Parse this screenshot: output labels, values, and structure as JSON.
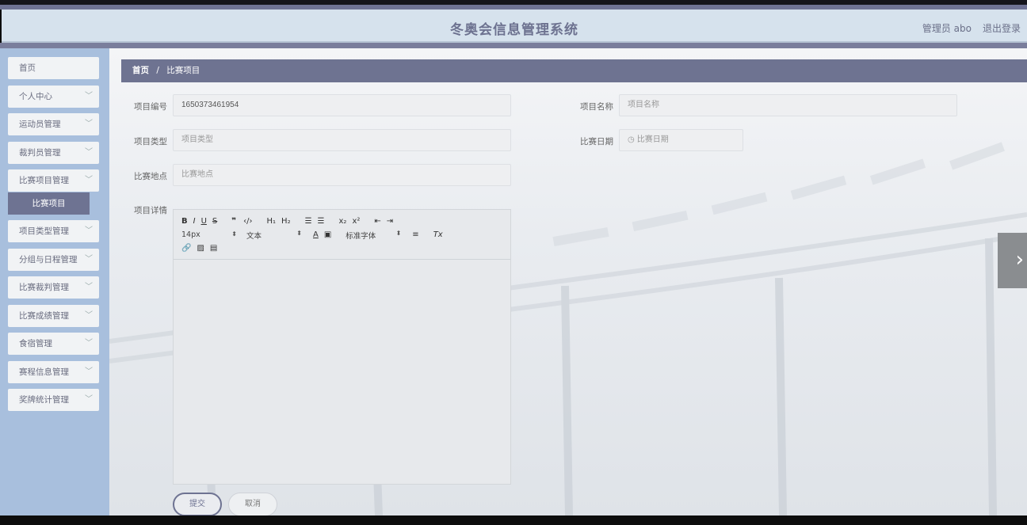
{
  "header": {
    "title": "冬奥会信息管理系统",
    "user": "管理员 abo",
    "logout": "退出登录"
  },
  "sidebar": {
    "items": [
      {
        "label": "首页",
        "has_arrow": false
      },
      {
        "label": "个人中心",
        "has_arrow": true
      },
      {
        "label": "运动员管理",
        "has_arrow": true
      },
      {
        "label": "裁判员管理",
        "has_arrow": true
      },
      {
        "label": "比赛项目管理",
        "has_arrow": true
      },
      {
        "label": "项目类型管理",
        "has_arrow": true
      },
      {
        "label": "分组与日程管理",
        "has_arrow": true
      },
      {
        "label": "比赛裁判管理",
        "has_arrow": true
      },
      {
        "label": "比赛成绩管理",
        "has_arrow": true
      },
      {
        "label": "食宿管理",
        "has_arrow": true
      },
      {
        "label": "赛程信息管理",
        "has_arrow": true
      },
      {
        "label": "奖牌统计管理",
        "has_arrow": true
      }
    ],
    "active_sub": "比赛项目"
  },
  "breadcrumb": {
    "home": "首页",
    "separator": "/",
    "current": "比赛项目"
  },
  "form": {
    "code_label": "项目编号",
    "code_value": "1650373461954",
    "name_label": "项目名称",
    "name_placeholder": "项目名称",
    "type_label": "项目类型",
    "type_placeholder": "项目类型",
    "date_label": "比赛日期",
    "date_placeholder": "比赛日期",
    "place_label": "比赛地点",
    "place_placeholder": "比赛地点",
    "detail_label": "项目详情"
  },
  "editor": {
    "font_size": "14px",
    "text_style": "文本",
    "font_family": "标准字体"
  },
  "buttons": {
    "submit": "提交",
    "cancel": "取消"
  },
  "icons": {
    "dropdown": "chevron-down-icon",
    "calendar": "clock-icon",
    "carousel_next": "chevron-right-icon"
  }
}
